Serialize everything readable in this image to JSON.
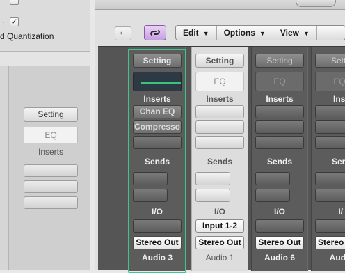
{
  "inspector": {
    "colon": ":",
    "check_mark": "✓",
    "quantization_label": "d Quantization",
    "setting_label": "Setting",
    "eq_label": "EQ",
    "inserts_label": "Inserts"
  },
  "toolbar": {
    "back_glyph": "⇠",
    "menus": [
      {
        "label": "Edit",
        "arrow": "▼"
      },
      {
        "label": "Options",
        "arrow": "▼"
      },
      {
        "label": "View",
        "arrow": "▼"
      }
    ]
  },
  "strips": [
    {
      "setting": "Setting",
      "eq": "",
      "inserts_label": "Inserts",
      "inserts": [
        "Chan EQ",
        "Compresso",
        ""
      ],
      "sends_label": "Sends",
      "io_label": "I/O",
      "input": "",
      "output": "Stereo Out",
      "name": "Audio 3"
    },
    {
      "setting": "Setting",
      "eq": "EQ",
      "inserts_label": "Inserts",
      "inserts": [
        "",
        "",
        ""
      ],
      "sends_label": "Sends",
      "io_label": "I/O",
      "input": "Input 1-2",
      "output": "Stereo Out",
      "name": "Audio 1"
    },
    {
      "setting": "Setting",
      "eq": "EQ",
      "inserts_label": "Inserts",
      "inserts": [
        "",
        "",
        ""
      ],
      "sends_label": "Sends",
      "io_label": "I/O",
      "input": "",
      "output": "Stereo Out",
      "name": "Audio 6"
    },
    {
      "setting": "Setti",
      "eq": "EQ",
      "inserts_label": "Inse",
      "inserts": [
        "",
        "",
        ""
      ],
      "sends_label": "Sen",
      "io_label": "I/",
      "input": "",
      "output": "Stereo",
      "name": "Aud"
    }
  ],
  "colors": {
    "selection": "#3fc48e",
    "link_button": "#c79ee2"
  }
}
